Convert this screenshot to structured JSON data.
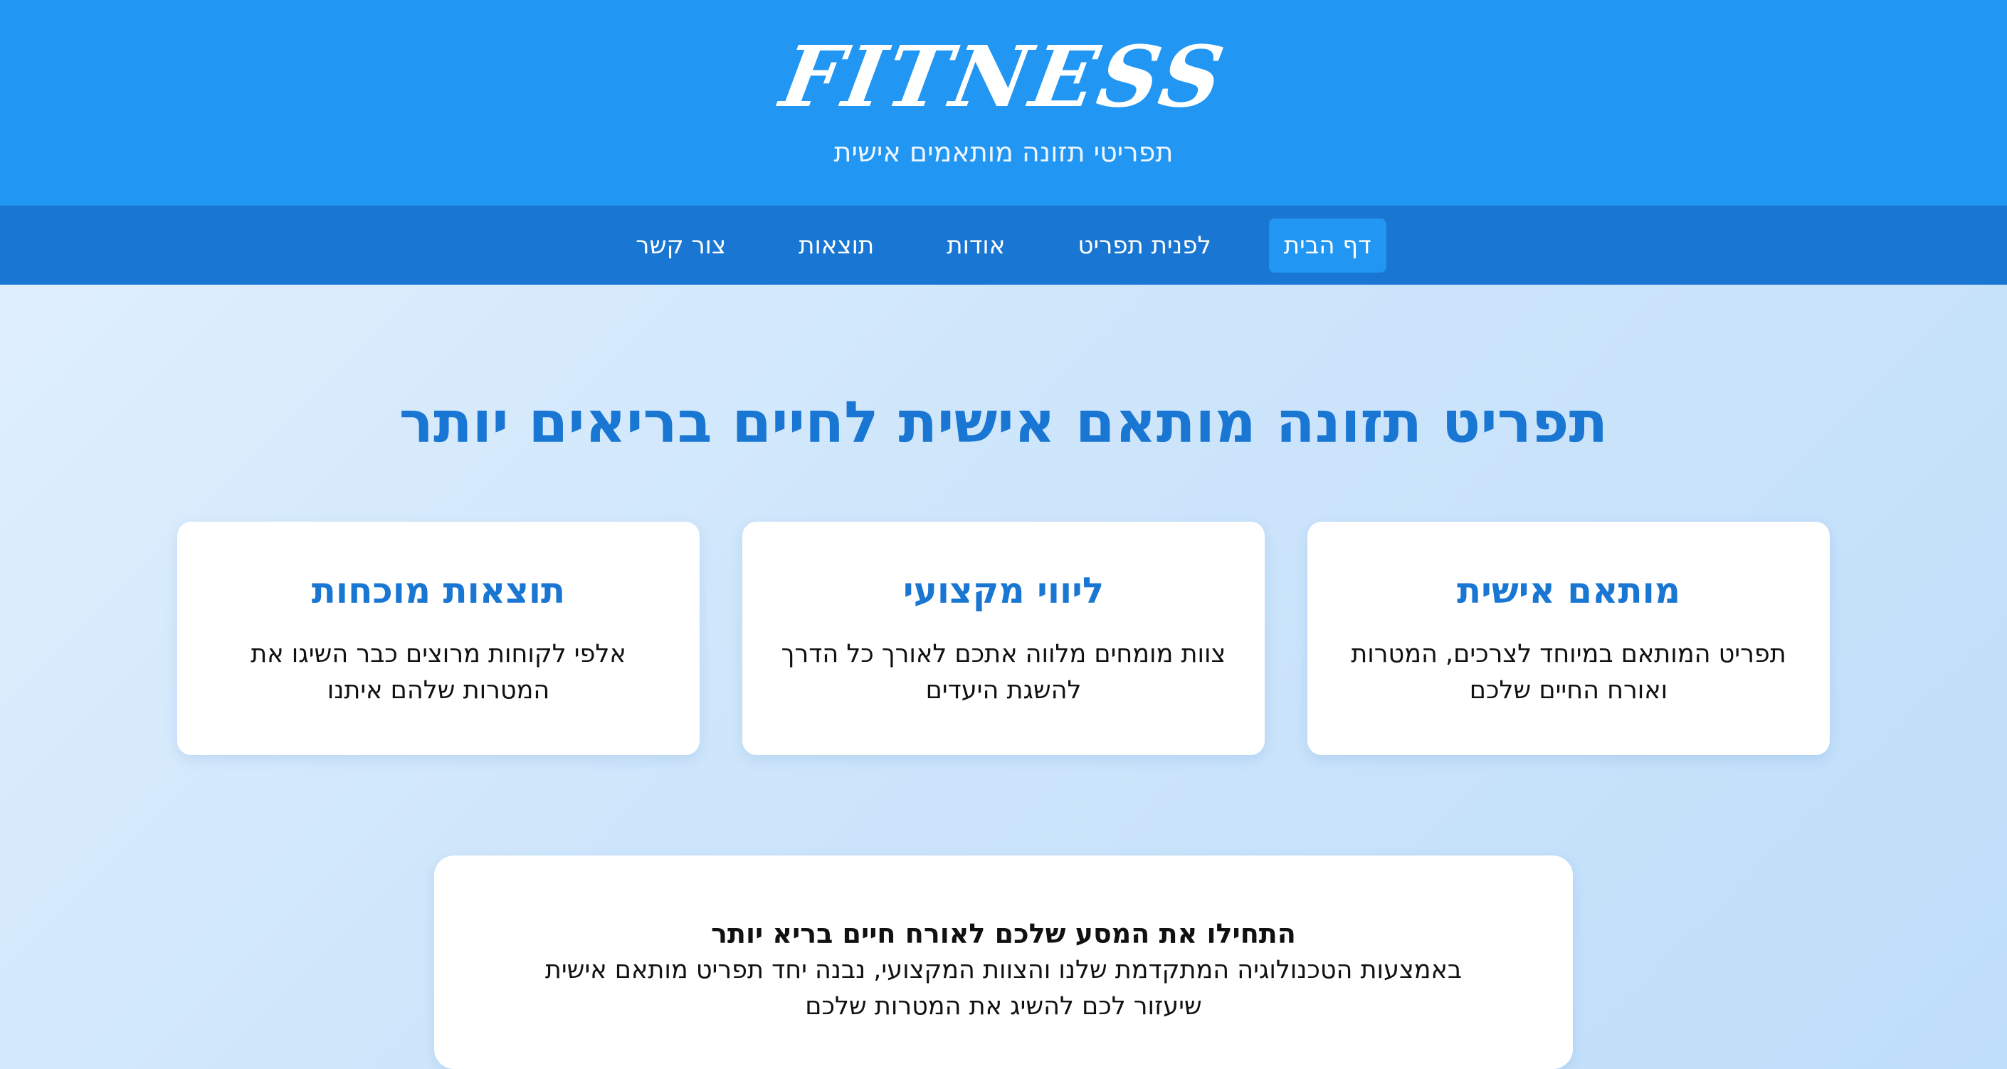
{
  "header": {
    "logo": "FITNESS",
    "tagline": "תפריטי תזונה מותאמים אישית"
  },
  "nav": {
    "items": [
      {
        "label": "דף הבית"
      },
      {
        "label": "לפנית תפריט"
      },
      {
        "label": "אודות"
      },
      {
        "label": "תוצאות"
      },
      {
        "label": "צור קשר"
      }
    ],
    "active_index": 0
  },
  "hero": {
    "title": "תפריט תזונה מותאם אישית לחיים בריאים יותר"
  },
  "features": [
    {
      "title": "מותאם אישית",
      "text": "תפריט המותאם במיוחד לצרכים, המטרות ואורח החיים שלכם"
    },
    {
      "title": "ליווי מקצועי",
      "text": "צוות מומחים מלווה אתכם לאורך כל הדרך להשגת היעדים"
    },
    {
      "title": "תוצאות מוכחות",
      "text": "אלפי לקוחות מרוצים כבר השיגו את המטרות שלהם איתנו"
    }
  ],
  "cta": {
    "title": "התחילו את המסע שלכם לאורח חיים בריא יותר",
    "text": "באמצעות הטכנולוגיה המתקדמת שלנו והצוות המקצועי, נבנה יחד תפריט מותאם אישית שיעזור לכם להשיג את המטרות שלכם"
  },
  "colors": {
    "header_bg": "#2196f3",
    "nav_bg": "#1976d2",
    "accent": "#1976d2"
  }
}
